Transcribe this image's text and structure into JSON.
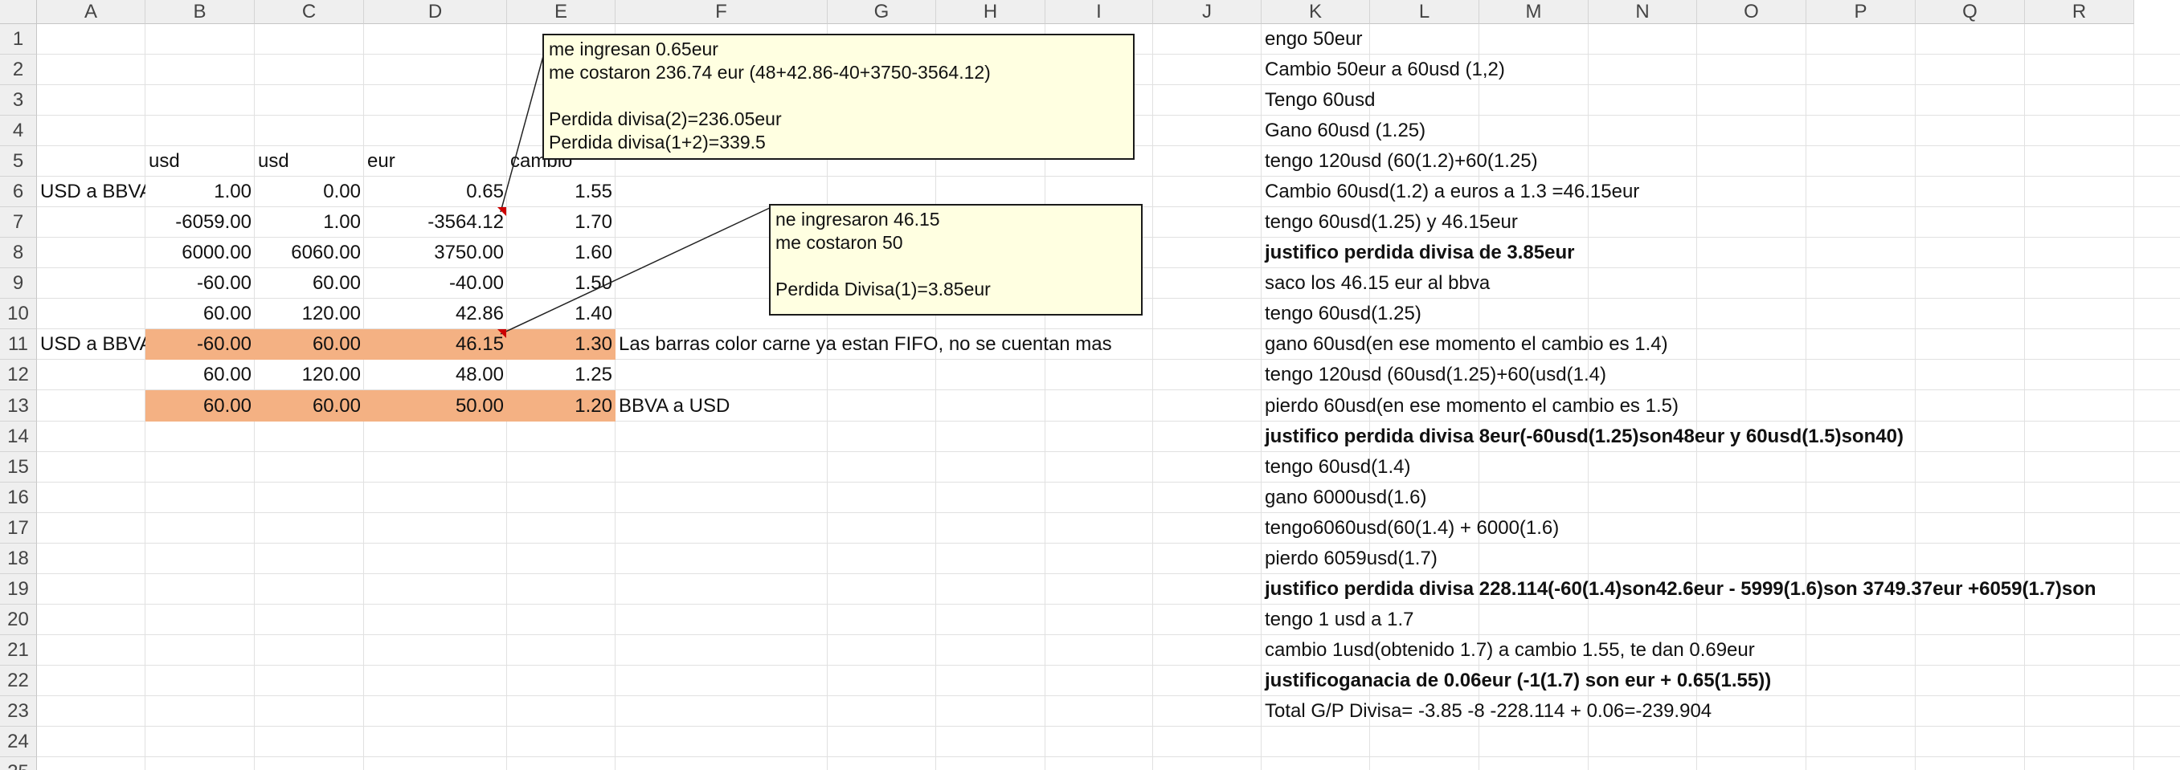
{
  "columns": [
    "A",
    "B",
    "C",
    "D",
    "E",
    "F",
    "G",
    "H",
    "I",
    "J",
    "K",
    "L",
    "M",
    "N",
    "O",
    "P",
    "Q",
    "R"
  ],
  "rows": [
    "1",
    "2",
    "3",
    "4",
    "5",
    "6",
    "7",
    "8",
    "9",
    "10",
    "11",
    "12",
    "13",
    "14",
    "15",
    "16",
    "17",
    "18",
    "19",
    "20",
    "21",
    "22",
    "23",
    "24",
    "25"
  ],
  "cells": {
    "B5": "usd",
    "C5": "usd",
    "D5": "eur",
    "E5": "cambio",
    "A6": "USD a BBVA",
    "B6": "1.00",
    "C6": "0.00",
    "D6": "0.65",
    "E6": "1.55",
    "B7": "-6059.00",
    "C7": "1.00",
    "D7": "-3564.12",
    "E7": "1.70",
    "B8": "6000.00",
    "C8": "6060.00",
    "D8": "3750.00",
    "E8": "1.60",
    "B9": "-60.00",
    "C9": "60.00",
    "D9": "-40.00",
    "E9": "1.50",
    "B10": "60.00",
    "C10": "120.00",
    "D10": "42.86",
    "E10": "1.40",
    "A11": "USD a BBVA",
    "B11": "-60.00",
    "C11": "60.00",
    "D11": "46.15",
    "E11": "1.30",
    "F11": "Las barras color carne ya estan FIFO, no se cuentan mas",
    "B12": "60.00",
    "C12": "120.00",
    "D12": "48.00",
    "E12": "1.25",
    "B13": "60.00",
    "C13": "60.00",
    "D13": "50.00",
    "E13": "1.20",
    "F13": "BBVA a USD"
  },
  "notes_column_k": [
    "engo 50eur",
    "Cambio 50eur a 60usd (1,2)",
    "Tengo 60usd",
    "Gano 60usd (1.25)",
    "tengo 120usd (60(1.2)+60(1.25)",
    "Cambio 60usd(1.2) a euros a 1.3  =46.15eur",
    "tengo 60usd(1.25) y 46.15eur",
    "justifico perdida divisa de 3.85eur",
    "saco los 46.15 eur al bbva",
    "tengo 60usd(1.25)",
    "gano 60usd(en ese momento el cambio es 1.4)",
    "tengo 120usd (60usd(1.25)+60(usd(1.4)",
    "pierdo 60usd(en ese momento el cambio es 1.5)",
    "justifico perdida divisa 8eur(-60usd(1.25)son48eur y 60usd(1.5)son40)",
    "tengo 60usd(1.4)",
    "gano 6000usd(1.6)",
    "tengo6060usd(60(1.4) + 6000(1.6)",
    "pierdo 6059usd(1.7)",
    "justifico perdida divisa 228.114(-60(1.4)son42.6eur - 5999(1.6)son 3749.37eur +6059(1.7)son",
    "tengo 1 usd a 1.7",
    "cambio 1usd(obtenido 1.7)  a cambio 1.55, te dan 0.69eur",
    "justificoganacia de 0.06eur (-1(1.7) son eur  + 0.65(1.55))",
    "Total G/P Divisa= -3.85 -8 -228.114 + 0.06=-239.904"
  ],
  "comments": {
    "comment1": {
      "lines": [
        "me ingresan 0.65eur",
        "me costaron 236.74 eur (48+42.86-40+3750-3564.12)",
        "",
        "Perdida divisa(2)=236.05eur",
        "Perdida divisa(1+2)=339.5"
      ]
    },
    "comment2": {
      "lines": [
        "ne ingresaron 46.15",
        "me costaron 50",
        "",
        "Perdida Divisa(1)=3.85eur"
      ]
    }
  },
  "colors": {
    "salmon_fill": "#f4b183",
    "comment_bg": "#ffffe1",
    "header_bg": "#efefef",
    "indicator": "#cc0000"
  }
}
